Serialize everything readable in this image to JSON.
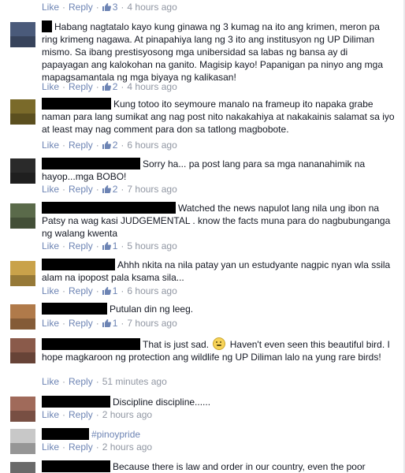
{
  "ui": {
    "like_label": "Like",
    "reply_label": "Reply",
    "dot": "·",
    "thumb_icon": "thumbs-up-icon",
    "link_color": "#6d84b4",
    "meta_color": "#9197a3"
  },
  "comments": [
    {
      "text": "",
      "likes": "3",
      "time": "4 hours ago"
    },
    {
      "text": "Habang nagtatalo kayo kung ginawa ng 3 kumag na ito ang krimen, meron pa ring krimeng nagawa. At pinapahiya lang ng 3 ito ang institusyon ng UP Diliman mismo. Sa ibang prestisyosong mga unibersidad sa labas ng bansa ay di papayagan ang kalokohan na ganito. Magisip kayo! Papanigan pa ninyo ang mga mapagsamantala ng mga biyaya ng kalikasan!",
      "likes": "2",
      "time": "4 hours ago"
    },
    {
      "text": "Kung totoo ito seymoure manalo na frameup ito napaka grabe naman para lang sumikat ang nag post nito nakakahiya at nakakainis salamat sa iyo at least may nag comment para don sa tatlong magbobote.",
      "likes": "2",
      "time": "6 hours ago"
    },
    {
      "text": "Sorry ha... pa post lang para sa mga nananahimik na hayop...mga BOBO!",
      "likes": "2",
      "time": "7 hours ago"
    },
    {
      "text": "Watched the news napulot lang nila ung ibon na Patsy na wag kasi JUDGEMENTAL . know the facts muna para do nagbubunganga ng walang kwenta",
      "likes": "1",
      "time": "5 hours ago"
    },
    {
      "text": "Ahhh nkita na nila patay yan un estudyante nagpic nyan wla ssila alam na ipopost pala ksama sila...",
      "likes": "1",
      "time": "6 hours ago"
    },
    {
      "text": "Putulan din ng leeg.",
      "likes": "1",
      "time": "7 hours ago"
    },
    {
      "text_a": "That is just sad.",
      "text_b": "Haven't even seen this beautiful bird. I hope magkaroon ng protection ang wildlife ng UP Diliman lalo na yung rare birds!",
      "time": "51 minutes ago"
    },
    {
      "text": "Discipline discipline......",
      "time": "2 hours ago"
    },
    {
      "text": "#pinoypride",
      "time": "2 hours ago"
    },
    {
      "text": "Because there is law and order in our country, even the poor"
    }
  ]
}
